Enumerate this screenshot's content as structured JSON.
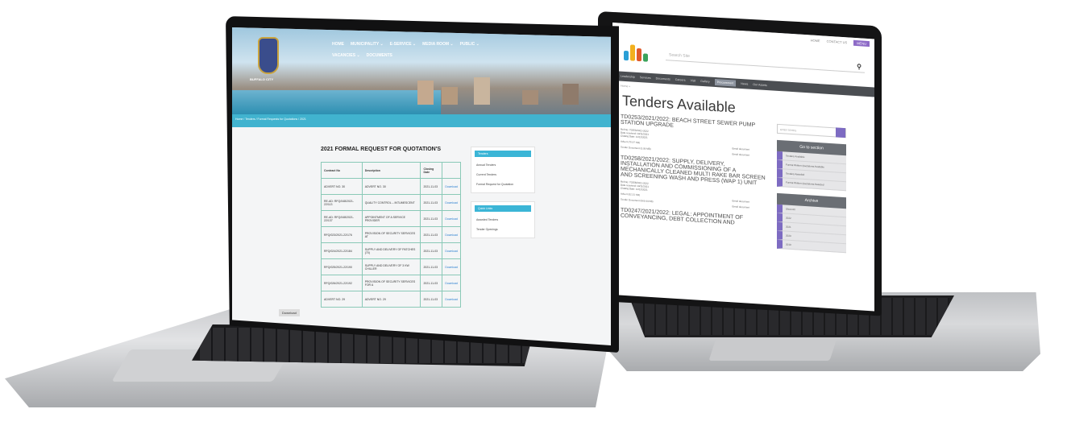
{
  "right_site": {
    "topbar": {
      "links": [
        "HOME",
        "CONTACT US"
      ],
      "pill": "MENU"
    },
    "logo_tagline": "Buffalo City",
    "search_placeholder": "Search Site",
    "nav": [
      "Leadership",
      "Services",
      "Documents",
      "Careers",
      "Visit",
      "Gallery",
      "Procurement",
      "News",
      "Our Assets"
    ],
    "nav_active_index": 6,
    "breadcrumb": "Home »",
    "title": "Tenders Available",
    "tenders": [
      {
        "heading": "TD0253/2021/2022: BEACH STREET SEWER PUMP STATION UPGRADE",
        "meta": [
          "Ref No: T0253/2021-2022",
          "Date received: 10/11/2021",
          "Closing Date: 11/12/2021"
        ],
        "docs": [
          [
            "Advert (75.97 KB)",
            "Email document"
          ],
          [
            "Tender Document (3.09 MB)",
            "Email document"
          ]
        ]
      },
      {
        "heading": "TD0258/2021/2022: SUPPLY, DELIVERY, INSTALLATION AND COMMISSIONING OF A MECHANICALLY CLEANED MULTI RAKE BAR SCREEN AND SCREENING WASH AND PRESS (WAP 1) UNIT",
        "meta": [
          "Ref No: T0258/2021-2022",
          "Date received: 10/11/2021",
          "Closing Date: 11/12/2021"
        ],
        "docs": [
          [
            "Advert (92.31 KB)",
            "Email document"
          ],
          [
            "Tender Document (569.44 KB)",
            "Email document"
          ]
        ]
      },
      {
        "heading": "TD0247/2021/2022: LEGAL: APPOINTMENT OF CONVEYANCING, DEBT COLLECTION AND",
        "meta": [],
        "docs": []
      }
    ],
    "sidebar": {
      "search_placeholder": "enter terms",
      "goto_title": "Go to section",
      "goto_items": [
        "Tenders Available",
        "Formal Written Quotations Available",
        "Tenders Awarded",
        "Formal Written Quotations Awarded"
      ],
      "archive_title": "Archive",
      "archive_items": [
        "Show All",
        "2022",
        "2021",
        "2020",
        "2019"
      ]
    }
  },
  "left_site": {
    "city_name": "BUFFALO CITY",
    "nav": [
      "HOME",
      "MUNICIPALITY ⌄",
      "E-SERVICE ⌄",
      "MEDIA ROOM ⌄",
      "PUBLIC ⌄",
      "VACANCIES ⌄",
      "DOCUMENTS"
    ],
    "breadcrumb": "Home  /  Tenders  /  Formal Requests for Quotations  /  2021",
    "title": "2021 FORMAL REQUEST FOR QUOTATION'S",
    "columns": [
      "Contract No",
      "Description",
      "Closing Date",
      ""
    ],
    "rows": [
      [
        "ADVERT NO. 30",
        "ADVERT NO. 30",
        "2021-11-03",
        "Download"
      ],
      [
        "RE-AD: RFQ/048/2021-22/113",
        "QUALITY CONTROL – INTUMESCENT",
        "2021-11-03",
        "Download"
      ],
      [
        "RE-AD: RFQ/048/2021-22/137",
        "APPOINTMENT OF A SERVICE PROVIDER",
        "2021-11-03",
        "Download"
      ],
      [
        "RFQ/023/2021-22/176",
        "PROVISION OF SECURITY SERVICES AT",
        "2021-11-03",
        "Download"
      ],
      [
        "RFQ/024/2021-22/184",
        "SUPPLY AND DELIVERY OF PATCHES (70)",
        "2021-11-03",
        "Download"
      ],
      [
        "RFQ/025/2021-22/190",
        "SUPPLY AND DELIVERY OF 3 KW CHILLER",
        "2021-11-03",
        "Download"
      ],
      [
        "RFQ/026/2021-22/192",
        "PROVISION OF SECURITY SERVICES FOR A",
        "2021-11-03",
        "Download"
      ],
      [
        "ADVERT NO. 29",
        "ADVERT NO. 29",
        "2021-11-03",
        "Download"
      ]
    ],
    "side_cards": [
      {
        "title": "Tenders",
        "items": [
          "Annual Tenders",
          "Current Tenders",
          "Formal Request for Quotation"
        ]
      },
      {
        "title": "Quick Links",
        "items": [
          "Awarded Tenders",
          "Tender Openings"
        ]
      }
    ],
    "footer_button": "Download"
  },
  "colors": {
    "teal": "#41b3cf",
    "purple": "#7d6bc2",
    "dark_nav": "#4b4e52"
  }
}
